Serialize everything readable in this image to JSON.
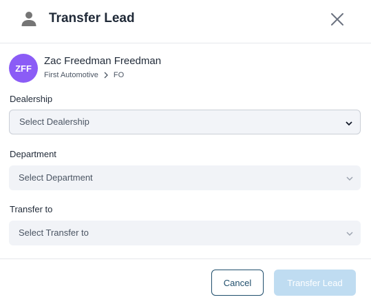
{
  "dialog": {
    "title": "Transfer Lead",
    "icon": "person-icon",
    "close_icon": "close-icon"
  },
  "lead": {
    "initials": "ZFF",
    "avatar_color": "#8b5cf6",
    "name": "Zac Freedman Freedman",
    "breadcrumb": [
      "First Automotive",
      "FO"
    ]
  },
  "fields": {
    "dealership": {
      "label": "Dealership",
      "placeholder": "Select Dealership"
    },
    "department": {
      "label": "Department",
      "placeholder": "Select Department"
    },
    "transfer_to": {
      "label": "Transfer to",
      "placeholder": "Select Transfer to"
    }
  },
  "footer": {
    "cancel_label": "Cancel",
    "transfer_label": "Transfer Lead",
    "transfer_color": "#bfdcf1",
    "cancel_border_color": "#1e4d6b"
  }
}
